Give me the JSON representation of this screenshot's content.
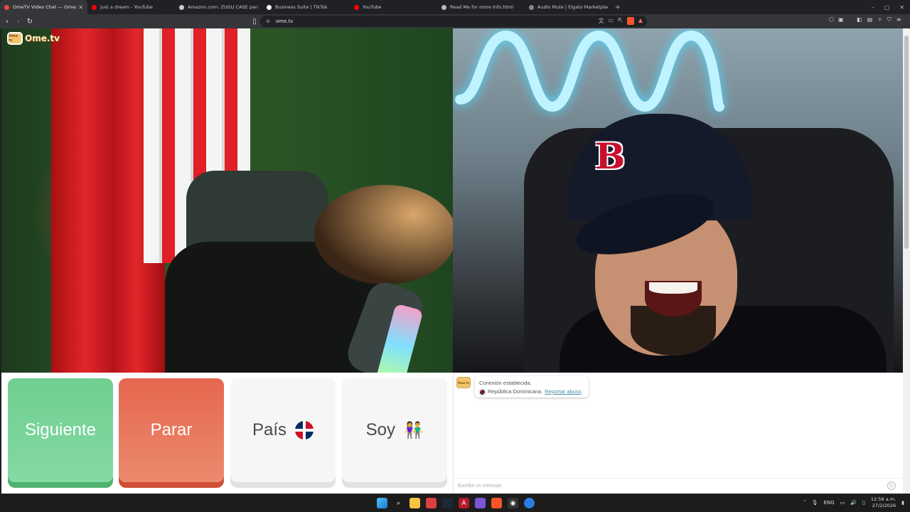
{
  "browser": {
    "tabs": [
      {
        "label": "OmeTV Video Chat — Omegle",
        "active": true,
        "favicon_color": "#e74c3c"
      },
      {
        "label": "just a dream - YouTube",
        "active": false,
        "favicon_color": "#ff0000"
      },
      {
        "label": "Amazon.com: ZUGU CASE para iPad",
        "active": false,
        "favicon_color": "#cccccc"
      },
      {
        "label": "Business Suite | TikTok",
        "active": false,
        "favicon_color": "#ffffff"
      },
      {
        "label": "YouTube",
        "active": false,
        "favicon_color": "#ff0000"
      },
      {
        "label": "Read Me for more Info.html",
        "active": false,
        "favicon_color": "#bbbbbb"
      },
      {
        "label": "Audio Mute | Elgato Marketplace",
        "active": false,
        "favicon_color": "#888888"
      }
    ],
    "new_tab_label": "+",
    "url": "ome.tv",
    "window_controls": {
      "minimize": "–",
      "maximize": "▢",
      "close": "✕"
    }
  },
  "site": {
    "logo_text": "Ome.tv",
    "logo_badge": "Ome tv"
  },
  "controls": {
    "next_label": "Siguiente",
    "stop_label": "Parar",
    "country_label": "País",
    "gender_label": "Soy",
    "gender_emoji": "👫"
  },
  "chat": {
    "avatar_text": "Ome tv",
    "status": "Conexión establecida.",
    "country": "República Dominicana.",
    "report_link": "Reportar abuso",
    "input_placeholder": "Escribe un mensaje",
    "emoji_button": "☺"
  },
  "taskbar": {
    "language": "ENG",
    "time": "12:58 a.m.",
    "date": "27/2/2026"
  },
  "colors": {
    "next_green": "#6fcf8f",
    "stop_red": "#e5674f",
    "brand_yellow": "#f2c46d"
  }
}
